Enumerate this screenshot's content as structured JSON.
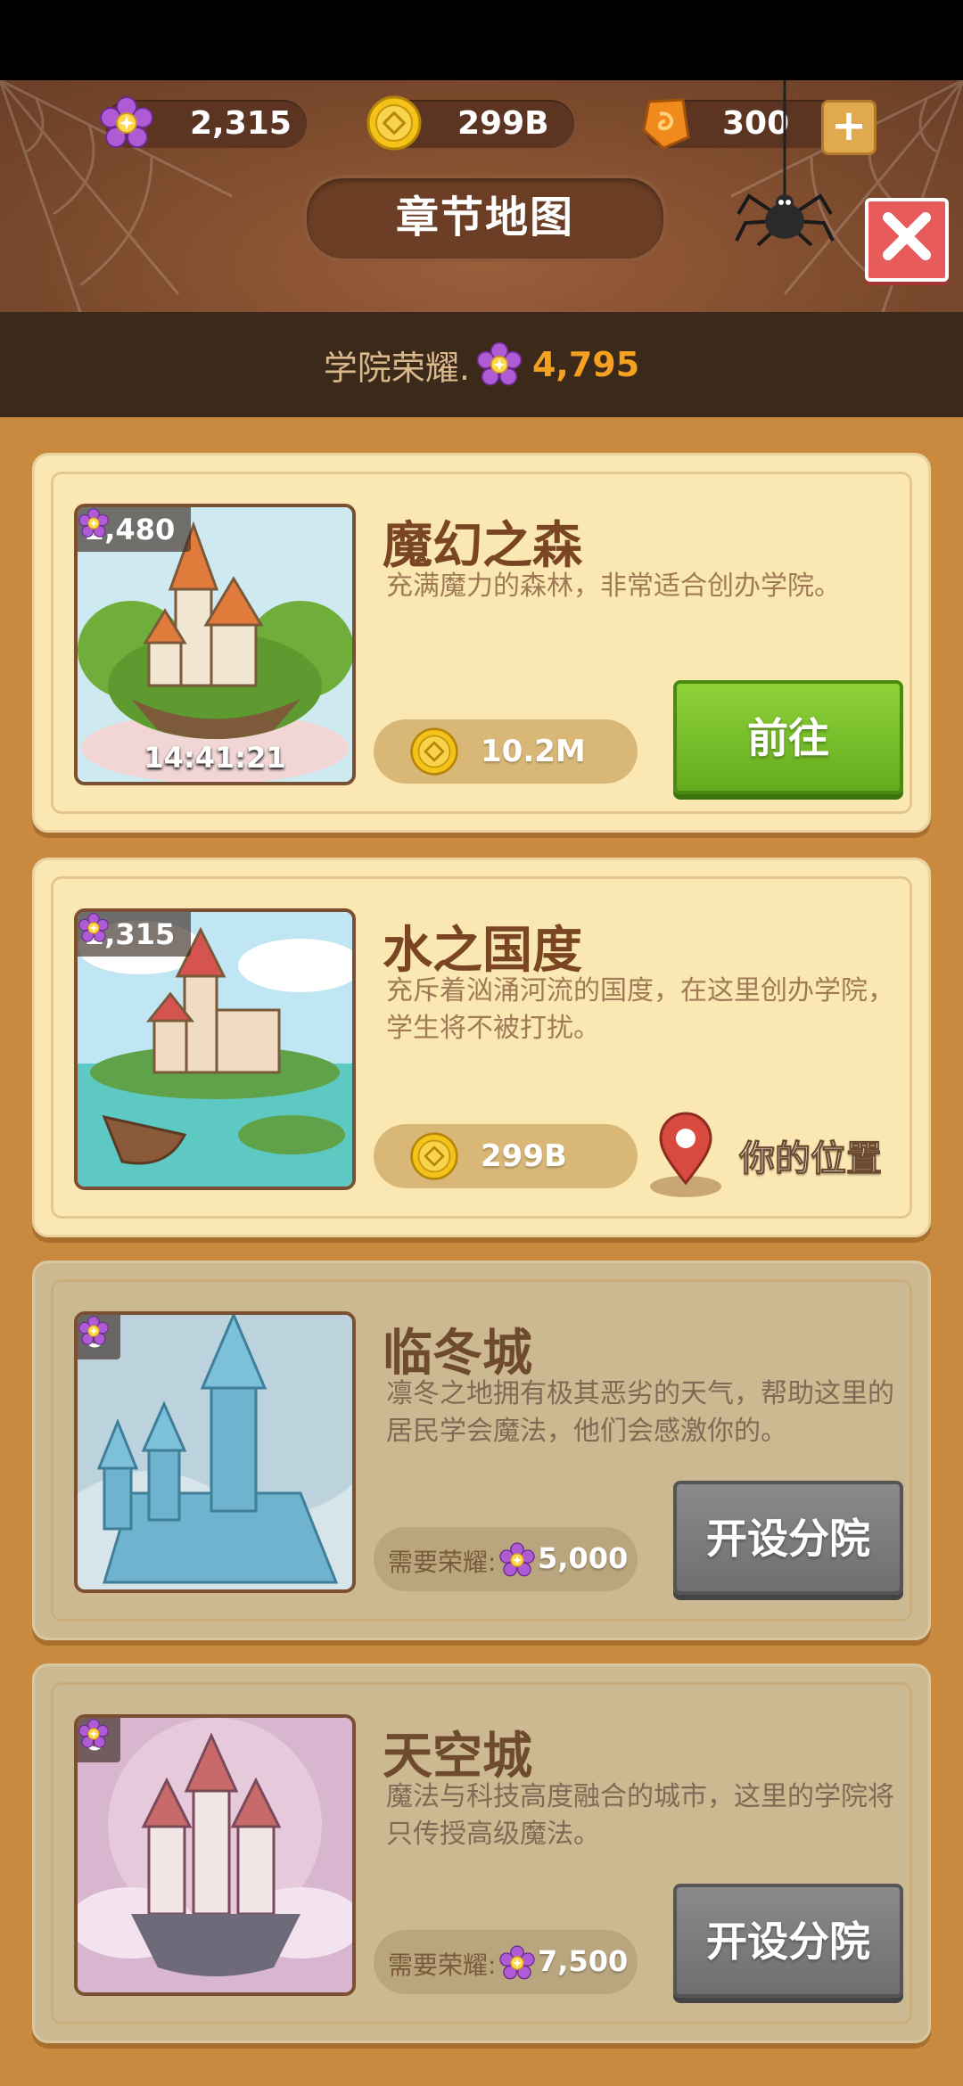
{
  "resources": {
    "flowers": "2,315",
    "coins": "299B",
    "gems": "300"
  },
  "header": {
    "title": "章节地图"
  },
  "honor": {
    "label": "学院荣耀.",
    "value": "4,795"
  },
  "chapters": [
    {
      "title": "魔幻之森",
      "description": "充满魔力的森林，非常适合创办学院。",
      "thumb_honor": "2,480",
      "timer": "14:41:21",
      "cost": "10.2M",
      "action": "前往",
      "state": "open"
    },
    {
      "title": "水之国度",
      "description": "充斥着汹涌河流的国度，在这里创办学院，学生将不被打扰。",
      "thumb_honor": "2,315",
      "cost": "299B",
      "location_label": "你的位置",
      "state": "current"
    },
    {
      "title": "临冬城",
      "description": "凛冬之地拥有极其恶劣的天气，帮助这里的居民学会魔法，他们会感激你的。",
      "thumb_honor": "0",
      "requirement_label": "需要荣耀:",
      "requirement_value": "5,000",
      "action": "开设分院",
      "state": "locked"
    },
    {
      "title": "天空城",
      "description": "魔法与科技高度融合的城市，这里的学院将只传授高级魔法。",
      "thumb_honor": "0",
      "requirement_label": "需要荣耀:",
      "requirement_value": "7,500",
      "action": "开设分院",
      "state": "locked"
    }
  ],
  "colors": {
    "accent_orange": "#f5a020",
    "go_green": "#74bf23",
    "locked_gray": "#7a7a7a",
    "close_red": "#e85b5b"
  },
  "icons": [
    "flower-icon",
    "coin-icon",
    "gem-icon",
    "plus-icon",
    "close-icon",
    "spider-icon",
    "location-pin-icon"
  ]
}
